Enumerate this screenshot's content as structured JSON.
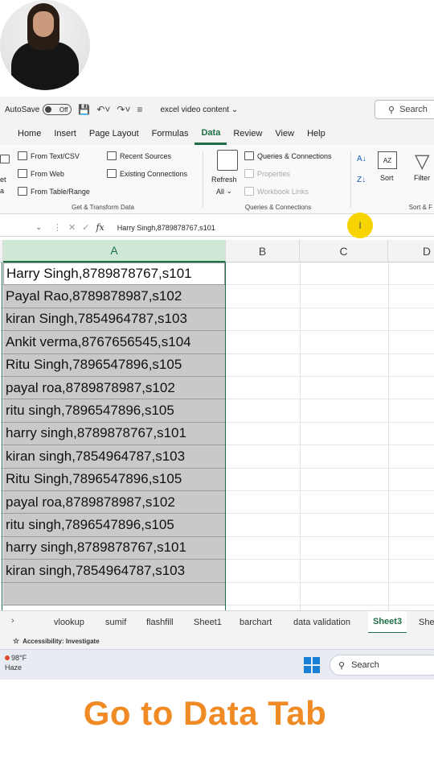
{
  "title_bar": {
    "autosave_label": "AutoSave",
    "autosave_state": "Off",
    "document_title": "excel video content",
    "search_label": "Search"
  },
  "ribbon_tabs": [
    "Home",
    "Insert",
    "Page Layout",
    "Formulas",
    "Data",
    "Review",
    "View",
    "Help"
  ],
  "active_tab": "Data",
  "ribbon": {
    "get_transform": {
      "partial_left_a": "et",
      "partial_left_b": "a",
      "items": [
        "From Text/CSV",
        "From Web",
        "From Table/Range",
        "Recent Sources",
        "Existing Connections"
      ],
      "group_label": "Get & Transform Data"
    },
    "queries": {
      "refresh_label": "Refresh",
      "refresh_all_label": "All",
      "items": [
        "Queries & Connections",
        "Properties",
        "Workbook Links"
      ],
      "group_label": "Queries & Connections"
    },
    "sort_filter": {
      "sort_label": "Sort",
      "filter_label": "Filter",
      "group_label": "Sort & F"
    }
  },
  "formula_bar": {
    "fx_label": "fx",
    "content": "Harry Singh,8789878767,s101"
  },
  "columns": [
    "A",
    "B",
    "C",
    "D"
  ],
  "cells_a": [
    "Harry Singh,8789878767,s101",
    "Payal Rao,8789878987,s102",
    "kiran Singh,7854964787,s103",
    "Ankit verma,8767656545,s104",
    "Ritu Singh,7896547896,s105",
    "payal roa,8789878987,s102",
    "ritu singh,7896547896,s105",
    "harry singh,8789878767,s101",
    "kiran singh,7854964787,s103",
    "Ritu Singh,7896547896,s105",
    "payal roa,8789878987,s102",
    "ritu singh,7896547896,s105",
    "harry singh,8789878767,s101",
    "kiran singh,7854964787,s103"
  ],
  "sheet_tabs": [
    "vlookup",
    "sumif",
    "flashfill",
    "Sheet1",
    "barchart",
    "data validation",
    "Sheet3",
    "She"
  ],
  "active_sheet": "Sheet3",
  "status_bar": {
    "accessibility": "Accessibility: Investigate"
  },
  "taskbar": {
    "temperature": "98°F",
    "weather": "Haze",
    "search_label": "Search"
  },
  "caption": "Go to Data Tab",
  "colors": {
    "excel_green": "#1e7145",
    "caption_orange": "#f08a24",
    "cursor_highlight": "#f5d400"
  }
}
